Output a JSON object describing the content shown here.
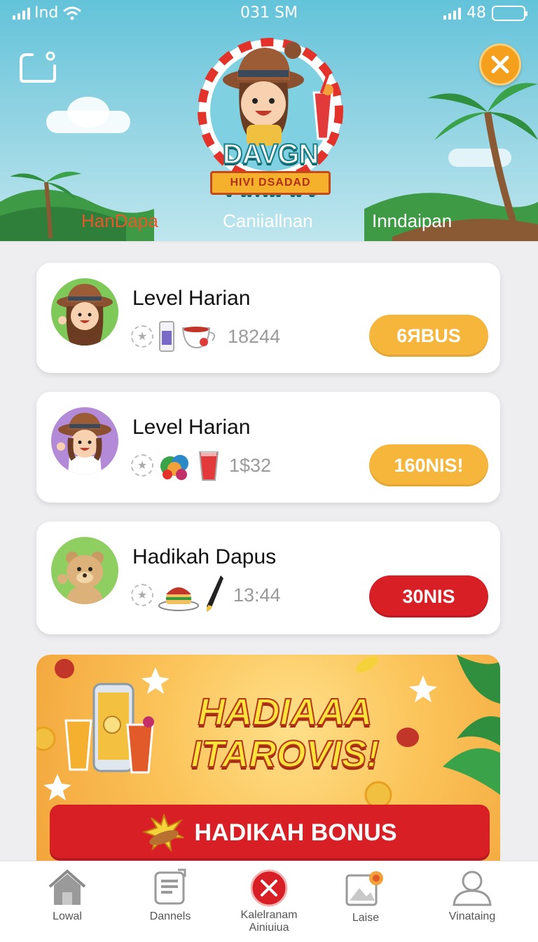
{
  "status_bar": {
    "carrier": "Ind",
    "time": "031 SM",
    "battery_text": "48"
  },
  "header": {
    "logo_title": "DAVGN AMIAR",
    "logo_subtitle": "HIVI DSADAD",
    "tabs": [
      {
        "label": "HanDapa",
        "active": true
      },
      {
        "label": "Caniiallnan",
        "active": false
      },
      {
        "label": "Inndaipan",
        "active": false
      }
    ]
  },
  "levels": [
    {
      "title": "Level Harian",
      "time": "18244",
      "button": "6ЯBUS",
      "avatar": "girl-hat-avatar",
      "style": "orange"
    },
    {
      "title": "Level Harian",
      "time": "1$32",
      "button": "160NIS!",
      "avatar": "girl-hat-purple-avatar",
      "style": "orange"
    },
    {
      "title": "Hadikah Dapus",
      "time": "13:44",
      "button": "30NIS",
      "avatar": "bear-avatar",
      "style": "red"
    }
  ],
  "promo": {
    "title_line1": "HADIAAA",
    "title_line2": "ITAROVIS!",
    "button": "HADIKAH BONUS"
  },
  "bottom_nav": [
    {
      "label": "Lowal",
      "icon": "home-icon"
    },
    {
      "label": "Dannels",
      "icon": "document-icon"
    },
    {
      "label_line1": "Kalelranam",
      "label_line2": "Ainiuiua",
      "icon": "close-circle-icon"
    },
    {
      "label": "Laise",
      "icon": "gallery-icon"
    },
    {
      "label": "Vinataing",
      "icon": "profile-icon"
    }
  ],
  "colors": {
    "accent_orange": "#f6b63c",
    "accent_red": "#d81f26",
    "sky": "#63c3d9",
    "active_tab": "#e8562a"
  }
}
